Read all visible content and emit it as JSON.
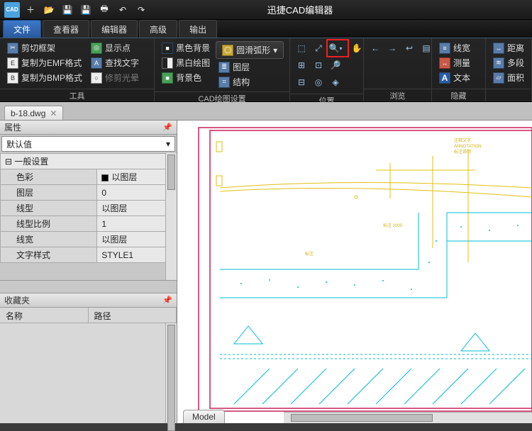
{
  "app": {
    "title": "迅捷CAD编辑器",
    "logo": "CAD"
  },
  "qat": {
    "new": "＋",
    "open": "📂",
    "save": "💾",
    "saveall": "💾",
    "print": "🖶",
    "undo": "↶",
    "redo": "↷"
  },
  "tabs": {
    "file": "文件",
    "viewer": "查看器",
    "editor": "编辑器",
    "advanced": "高级",
    "output": "输出"
  },
  "ribbon": {
    "tool": {
      "label": "工具",
      "crop": "剪切框架",
      "copy_emf": "复制为EMF格式",
      "copy_bmp": "复制为BMP格式",
      "show_point": "显示点",
      "find_text": "查找文字",
      "trim_halo": "修剪光晕"
    },
    "cad": {
      "label": "CAD绘图设置",
      "black_bg": "黑色背景",
      "bw_draw": "黑白绘图",
      "bg_color": "背景色",
      "smooth_arc": "圆滑弧形",
      "layer": "图层",
      "struct": "结构"
    },
    "pos": {
      "label": "位置"
    },
    "view": {
      "label": "浏览",
      "line_width": "线宽",
      "measure": "测量",
      "text": "文本"
    },
    "hide": {
      "label": "隐藏",
      "distance": "距离",
      "multi": "多段",
      "area": "面积"
    }
  },
  "doc": {
    "name": "b-18.dwg"
  },
  "props": {
    "title": "属性",
    "default": "默认值",
    "group": "一般设置",
    "rows": [
      {
        "k": "色彩",
        "v": "以图层",
        "swatch": true
      },
      {
        "k": "图层",
        "v": "0"
      },
      {
        "k": "线型",
        "v": "以图层"
      },
      {
        "k": "线型比例",
        "v": "1"
      },
      {
        "k": "线宽",
        "v": "以图层"
      },
      {
        "k": "文字样式",
        "v": "STYLE1"
      }
    ]
  },
  "fav": {
    "title": "收藏夹",
    "col_name": "名称",
    "col_path": "路径"
  },
  "canvas": {
    "tab": "Model"
  }
}
